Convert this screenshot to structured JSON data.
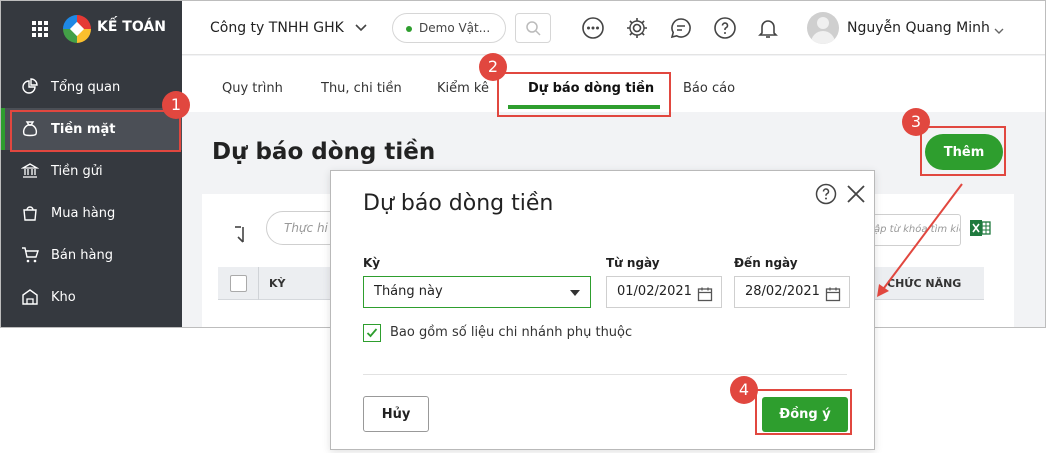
{
  "app": {
    "brand": "KẾ TOÁN"
  },
  "sidebar": {
    "items": [
      {
        "label": "Tổng quan",
        "icon": "chart-pie-icon"
      },
      {
        "label": "Tiền mặt",
        "icon": "money-bag-icon",
        "active": true
      },
      {
        "label": "Tiền gửi",
        "icon": "bank-icon"
      },
      {
        "label": "Mua hàng",
        "icon": "shopping-bag-icon"
      },
      {
        "label": "Bán hàng",
        "icon": "cart-icon"
      },
      {
        "label": "Kho",
        "icon": "warehouse-icon"
      }
    ]
  },
  "header": {
    "company": "Công ty TNHH GHK",
    "demo": "Demo Vật...",
    "user": "Nguyễn Quang Minh"
  },
  "tabs": [
    {
      "label": "Quy trình"
    },
    {
      "label": "Thu, chi tiền"
    },
    {
      "label": "Kiểm kê"
    },
    {
      "label": "Dự báo dòng tiền",
      "active": true
    },
    {
      "label": "Báo cáo"
    }
  ],
  "main": {
    "title": "Dự báo dòng tiền",
    "add_label": "Thêm",
    "filter_placeholder": "Thực hi",
    "search_placeholder": "ập từ khóa tìm kiếm",
    "col_ky": "KỲ",
    "col_func": "CHỨC NĂNG"
  },
  "dialog": {
    "title": "Dự báo dòng tiền",
    "ky_label": "Kỳ",
    "ky_value": "Tháng này",
    "from_label": "Từ ngày",
    "from_value": "01/02/2021",
    "to_label": "Đến ngày",
    "to_value": "28/02/2021",
    "checkbox_label": "Bao gồm số liệu chi nhánh phụ thuộc",
    "checkbox_checked": true,
    "cancel_label": "Hủy",
    "ok_label": "Đồng ý"
  },
  "annotations": [
    "1",
    "2",
    "3",
    "4"
  ],
  "colors": {
    "accent": "#2e9e2e",
    "annotation": "#e1473f",
    "sidebar": "#35393f"
  }
}
